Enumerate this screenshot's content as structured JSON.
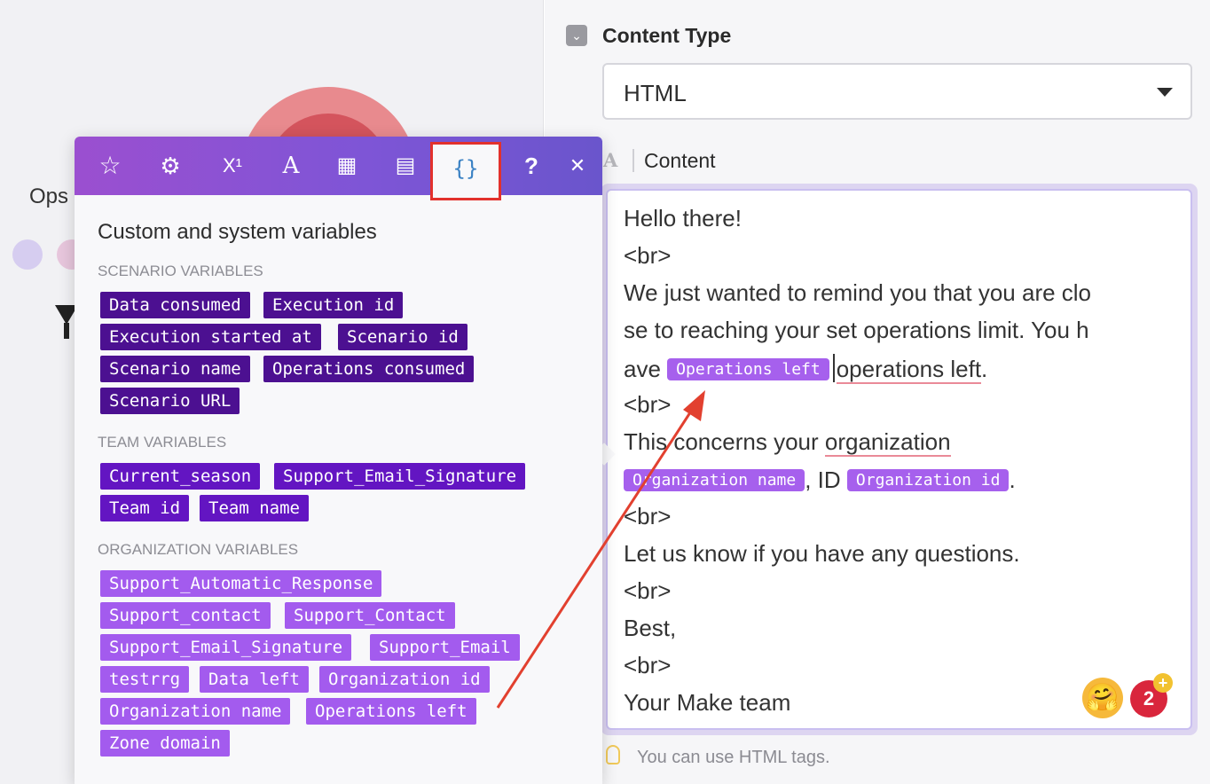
{
  "canvas": {
    "label": "Ops"
  },
  "content_type": {
    "label": "Content Type",
    "value": "HTML"
  },
  "content": {
    "label": "Content",
    "line1": "Hello there!",
    "br": "<br>",
    "line3": "We just wanted to remind you that you are clo",
    "line4": "se to reaching your set operations limit. You h",
    "line5_prefix": "ave ",
    "pill_operations_left": "Operations left",
    "line5_suffix": "operations left",
    "line5_end": ".",
    "line7_prefix": "This concerns your ",
    "line7_word": "organization",
    "pill_org_name": "Organization name",
    "line8_mid": ", ID ",
    "pill_org_id": "Organization id",
    "line8_end": ".",
    "line10": "Let us know if you have any questions.",
    "line12": "Best,",
    "line14": "Your Make team",
    "emoji": "🤗",
    "badge_count": "2",
    "badge_plus": "+",
    "hint": "You can use HTML tags."
  },
  "popover": {
    "title": "Custom and system variables",
    "toolbar": {
      "favorites": "☆",
      "settings": "⚙",
      "math": "X¹",
      "text": "A",
      "date": "▦",
      "table": "▤",
      "variables": "{}",
      "help": "?",
      "close": "✕"
    },
    "scenario_heading": "SCENARIO VARIABLES",
    "scenario": [
      "Data consumed",
      "Execution id",
      "Execution started at",
      "Scenario id",
      "Scenario name",
      "Operations consumed",
      "Scenario URL"
    ],
    "team_heading": "TEAM VARIABLES",
    "team": [
      "Current_season",
      "Support_Email_Signature",
      "Team id",
      "Team name"
    ],
    "org_heading": "ORGANIZATION VARIABLES",
    "org": [
      "Support_Automatic_Response",
      "Support_contact",
      "Support_Contact",
      "Support_Email_Signature",
      "Support_Email",
      "testrrg",
      "Data left",
      "Organization id",
      "Organization name",
      "Operations left",
      "Zone domain"
    ]
  },
  "colors": {
    "scenario_tag": "#4c1091",
    "team_tag": "#6315c2",
    "org_tag": "#a35bee",
    "highlight_border": "#e2312c",
    "arrow": "#e2402f"
  }
}
